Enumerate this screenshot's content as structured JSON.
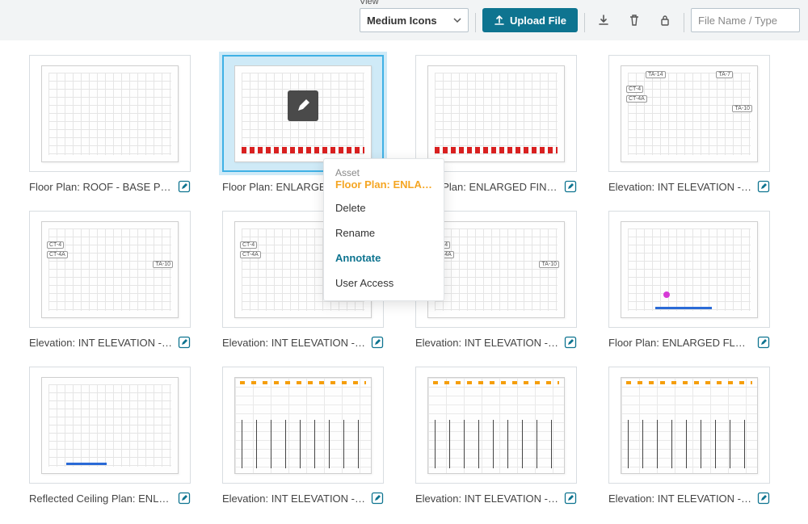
{
  "toolbar": {
    "view_label": "View",
    "view_value": "Medium Icons",
    "upload_label": "Upload File",
    "search_placeholder": "File Name / Type"
  },
  "context_menu": {
    "header": "Asset",
    "asset_name": "Floor Plan: ENLARGE…",
    "items": [
      {
        "label": "Delete",
        "active": false
      },
      {
        "label": "Rename",
        "active": false
      },
      {
        "label": "Annotate",
        "active": true
      },
      {
        "label": "User Access",
        "active": false
      }
    ]
  },
  "cards": [
    {
      "title": "Floor Plan: ROOF - BASE PL…",
      "selected": false,
      "kind": "grid"
    },
    {
      "title": "Floor Plan: ENLARGED FLO…",
      "selected": true,
      "kind": "redline-edit"
    },
    {
      "title": "Floor Plan: ENLARGED FINI…",
      "selected": false,
      "kind": "redline"
    },
    {
      "title": "Elevation: INT ELEVATION -…",
      "selected": false,
      "kind": "elevation-a"
    },
    {
      "title": "Elevation: INT ELEVATION -…",
      "selected": false,
      "kind": "elevation-b"
    },
    {
      "title": "Elevation: INT ELEVATION -…",
      "selected": false,
      "kind": "elevation-c"
    },
    {
      "title": "Elevation: INT ELEVATION -…",
      "selected": false,
      "kind": "elevation-d"
    },
    {
      "title": "Floor Plan: ENLARGED FLO…",
      "selected": false,
      "kind": "enlarged"
    },
    {
      "title": "Reflected Ceiling Plan: ENL…",
      "selected": false,
      "kind": "ceiling"
    },
    {
      "title": "Elevation: INT ELEVATION -…",
      "selected": false,
      "kind": "bike-a"
    },
    {
      "title": "Elevation: INT ELEVATION -…",
      "selected": false,
      "kind": "bike-b"
    },
    {
      "title": "Elevation: INT ELEVATION -…",
      "selected": false,
      "kind": "bike-c"
    }
  ]
}
